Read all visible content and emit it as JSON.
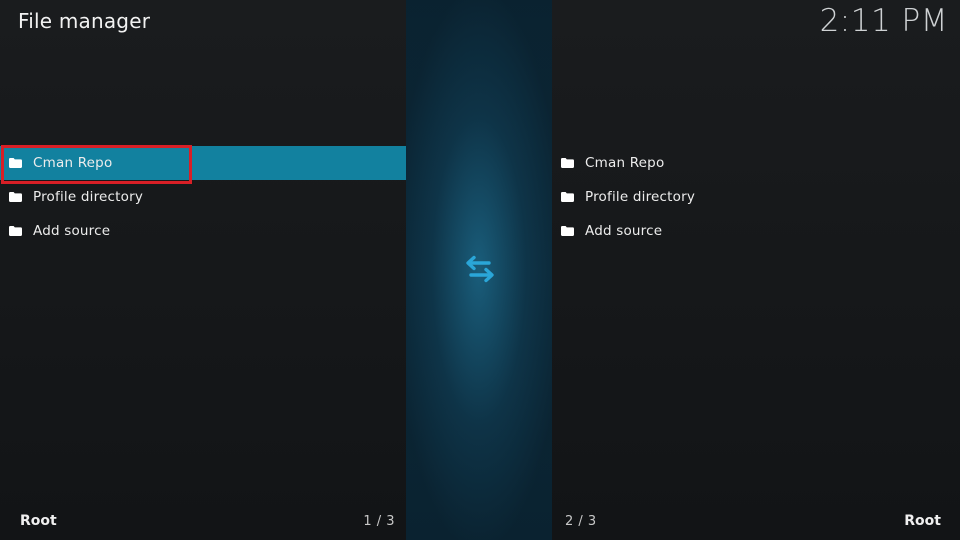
{
  "header": {
    "title": "File manager",
    "clock": "2:11 PM"
  },
  "left_pane": {
    "items": [
      {
        "label": "Cman Repo",
        "icon": "folder-icon",
        "focused": true
      },
      {
        "label": "Profile directory",
        "icon": "folder-icon",
        "focused": false
      },
      {
        "label": "Add source",
        "icon": "folder-icon",
        "focused": false
      }
    ],
    "path": "Root",
    "count": "1 / 3"
  },
  "divider": {
    "icon": "swap-arrows-icon"
  },
  "right_pane": {
    "items": [
      {
        "label": "Cman Repo",
        "icon": "folder-icon"
      },
      {
        "label": "Profile directory",
        "icon": "folder-icon"
      },
      {
        "label": "Add source",
        "icon": "folder-icon"
      }
    ],
    "path": "Root",
    "count": "2 / 3"
  },
  "colors": {
    "focus": "#12819f",
    "highlight_annotation": "#d81f26",
    "accent_icon": "#2aa6d8"
  }
}
